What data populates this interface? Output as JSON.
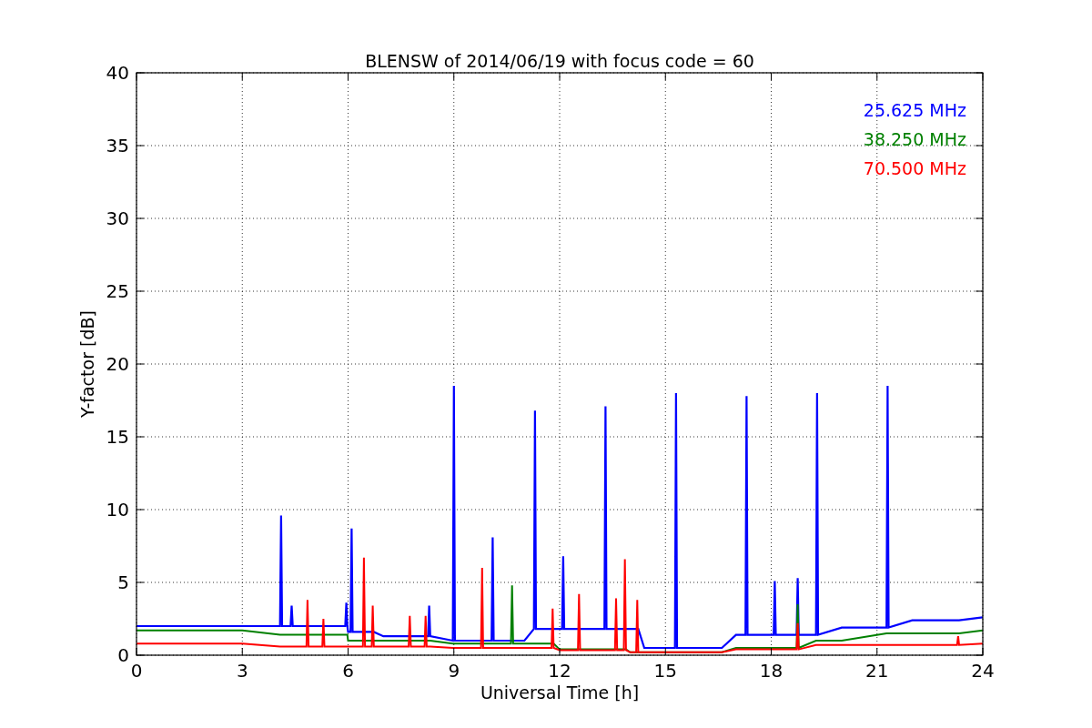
{
  "chart": {
    "chart_data": {
      "type": "line",
      "title": "BLENSW of 2014/06/19 with focus code = 60",
      "xlabel": "Universal Time [h]",
      "ylabel": "Y-factor [dB]",
      "x": [
        0,
        3,
        4.07,
        4.1,
        4.13,
        4.37,
        4.4,
        4.43,
        4.82,
        4.85,
        4.88,
        5.27,
        5.3,
        5.33,
        5.92,
        5.95,
        5.98,
        6,
        6.07,
        6.1,
        6.13,
        6.42,
        6.45,
        6.48,
        6.67,
        6.7,
        6.73,
        7,
        7.72,
        7.75,
        7.78,
        8.17,
        8.2,
        8.23,
        8.27,
        8.3,
        8.33,
        8.97,
        9,
        9.03,
        9.77,
        9.8,
        9.83,
        10.07,
        10.1,
        10.13,
        10.62,
        10.65,
        10.68,
        11,
        11.27,
        11.3,
        11.33,
        11.77,
        11.8,
        11.83,
        12,
        12.07,
        12.1,
        12.13,
        12.52,
        12.55,
        12.58,
        13.27,
        13.3,
        13.33,
        13.57,
        13.6,
        13.63,
        13.82,
        13.85,
        13.88,
        14,
        14.17,
        14.2,
        14.23,
        14.4,
        15.27,
        15.3,
        15.33,
        16.6,
        17,
        17.27,
        17.3,
        17.33,
        18.07,
        18.1,
        18.13,
        18.72,
        18.75,
        18.78,
        19.27,
        19.3,
        19.33,
        20,
        21.27,
        21.3,
        21.33,
        22,
        23.27,
        23.3,
        23.33,
        24
      ],
      "series": [
        {
          "name": "25.625 MHz",
          "color": "#0000ff",
          "values": [
            2.0,
            2.0,
            2.0,
            9.6,
            2.0,
            2.0,
            3.4,
            2.0,
            2.0,
            2.0,
            2.0,
            2.0,
            2.0,
            2.0,
            2.0,
            3.6,
            2.0,
            1.6,
            1.6,
            8.7,
            1.6,
            1.6,
            1.6,
            1.6,
            1.6,
            1.6,
            1.6,
            1.3,
            1.3,
            1.3,
            1.3,
            1.3,
            1.3,
            1.3,
            1.3,
            3.4,
            1.3,
            1.0,
            18.5,
            1.0,
            1.0,
            1.0,
            1.0,
            1.0,
            8.1,
            1.0,
            1.0,
            1.0,
            1.0,
            1.0,
            1.8,
            16.8,
            1.8,
            1.8,
            1.8,
            1.8,
            1.8,
            1.8,
            6.8,
            1.8,
            1.8,
            1.8,
            1.8,
            1.8,
            17.1,
            1.8,
            1.8,
            1.8,
            1.8,
            1.8,
            1.8,
            1.8,
            1.8,
            1.8,
            1.8,
            1.8,
            0.5,
            0.5,
            18.0,
            0.5,
            0.5,
            1.4,
            1.4,
            17.8,
            1.4,
            1.4,
            5.1,
            1.4,
            1.4,
            5.3,
            1.4,
            1.4,
            18.0,
            1.4,
            1.9,
            1.9,
            18.5,
            1.9,
            2.4,
            2.4,
            2.4,
            2.4,
            2.6
          ]
        },
        {
          "name": "38.250 MHz",
          "color": "#008000",
          "values": [
            1.7,
            1.7,
            1.4,
            1.4,
            1.4,
            1.4,
            1.4,
            1.4,
            1.4,
            1.4,
            1.4,
            1.4,
            1.4,
            1.4,
            1.4,
            1.4,
            1.4,
            1.0,
            1.0,
            1.0,
            1.0,
            1.0,
            1.0,
            1.0,
            1.0,
            1.0,
            1.0,
            1.0,
            1.0,
            1.0,
            1.0,
            1.0,
            1.0,
            1.0,
            1.0,
            1.0,
            1.0,
            0.8,
            0.8,
            0.8,
            0.8,
            0.8,
            0.8,
            0.8,
            0.8,
            0.8,
            0.8,
            4.8,
            0.8,
            0.8,
            0.8,
            0.8,
            0.8,
            0.8,
            0.8,
            0.8,
            0.4,
            0.4,
            0.4,
            0.4,
            0.4,
            0.4,
            0.4,
            0.4,
            0.4,
            0.4,
            0.4,
            0.4,
            0.4,
            0.4,
            0.4,
            0.4,
            0.2,
            0.2,
            0.2,
            0.2,
            0.2,
            0.2,
            0.2,
            0.2,
            0.2,
            0.5,
            0.5,
            0.5,
            0.5,
            0.5,
            0.5,
            0.5,
            0.5,
            3.5,
            0.5,
            1.0,
            1.0,
            1.0,
            1.0,
            1.5,
            1.5,
            1.5,
            1.5,
            1.5,
            1.5,
            1.5,
            1.7
          ]
        },
        {
          "name": "70.500 MHz",
          "color": "#ff0000",
          "values": [
            0.8,
            0.8,
            0.6,
            0.6,
            0.6,
            0.6,
            0.6,
            0.6,
            0.6,
            3.8,
            0.6,
            0.6,
            2.5,
            0.6,
            0.6,
            0.6,
            0.6,
            0.6,
            0.6,
            0.6,
            0.6,
            0.6,
            6.7,
            0.6,
            0.6,
            3.4,
            0.6,
            0.6,
            0.6,
            2.7,
            0.6,
            0.6,
            2.7,
            0.6,
            0.6,
            0.6,
            0.6,
            0.5,
            0.5,
            0.5,
            0.5,
            6.0,
            0.5,
            0.5,
            0.5,
            0.5,
            0.5,
            0.5,
            0.5,
            0.5,
            0.5,
            0.5,
            0.5,
            0.5,
            3.2,
            0.5,
            0.35,
            0.35,
            0.35,
            0.35,
            0.35,
            4.2,
            0.35,
            0.35,
            0.35,
            0.35,
            0.35,
            3.9,
            0.35,
            0.35,
            6.6,
            0.35,
            0.2,
            0.2,
            3.8,
            0.2,
            0.2,
            0.2,
            0.2,
            0.2,
            0.2,
            0.4,
            0.4,
            0.4,
            0.4,
            0.4,
            0.4,
            0.4,
            0.4,
            2.2,
            0.4,
            0.7,
            0.7,
            0.7,
            0.7,
            0.7,
            0.7,
            0.7,
            0.7,
            0.7,
            1.3,
            0.7,
            0.8
          ]
        }
      ],
      "grid": true,
      "xlim": [
        0,
        24
      ],
      "ylim": [
        0,
        40
      ],
      "xticks": [
        0,
        3,
        6,
        9,
        12,
        15,
        18,
        21,
        24
      ],
      "yticks": [
        0,
        5,
        10,
        15,
        20,
        25,
        30,
        35,
        40
      ]
    }
  }
}
